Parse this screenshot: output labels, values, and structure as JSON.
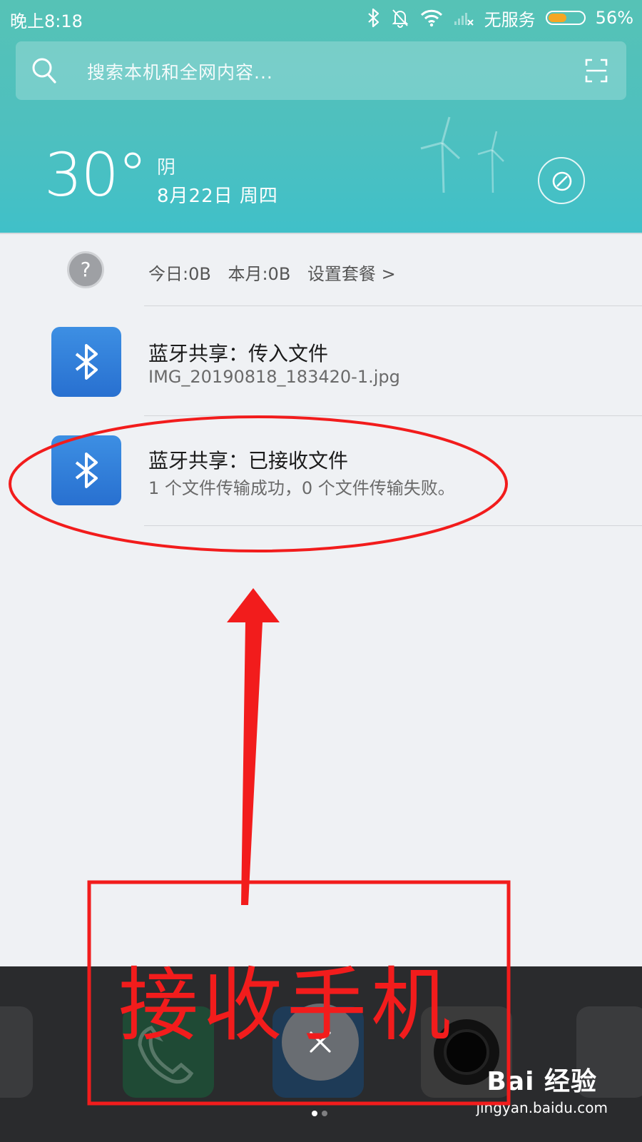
{
  "status_bar": {
    "time": "晚上8:18",
    "carrier": "无服务",
    "battery_percent": "56%",
    "battery_level": 0.56,
    "icons": [
      "bluetooth-icon",
      "mute-bell-icon",
      "wifi-icon",
      "no-signal-icon",
      "battery-icon"
    ]
  },
  "search": {
    "placeholder": "搜索本机和全网内容..."
  },
  "weather": {
    "temperature": "30°",
    "condition": "阴",
    "date": "8月22日 周四"
  },
  "data_usage": {
    "today": "今日:0B",
    "month": "本月:0B",
    "settings_link": "设置套餐 >"
  },
  "notifications": [
    {
      "title": "蓝牙共享：传入文件",
      "body": "IMG_20190818_183420-1.jpg",
      "icon": "bluetooth-icon"
    },
    {
      "title": "蓝牙共享：已接收文件",
      "body": "1 个文件传输成功，0 个文件传输失败。",
      "icon": "bluetooth-icon"
    }
  ],
  "annotation": {
    "label": "接收手机",
    "color": "#f21c1c"
  },
  "watermark": {
    "logo": "Bai  经验",
    "url": "jingyan.baidu.com"
  },
  "colors": {
    "header_teal": "#4ec0bf",
    "bluetooth_blue": "#2f7fdc",
    "panel_bg": "#eff1f4"
  }
}
